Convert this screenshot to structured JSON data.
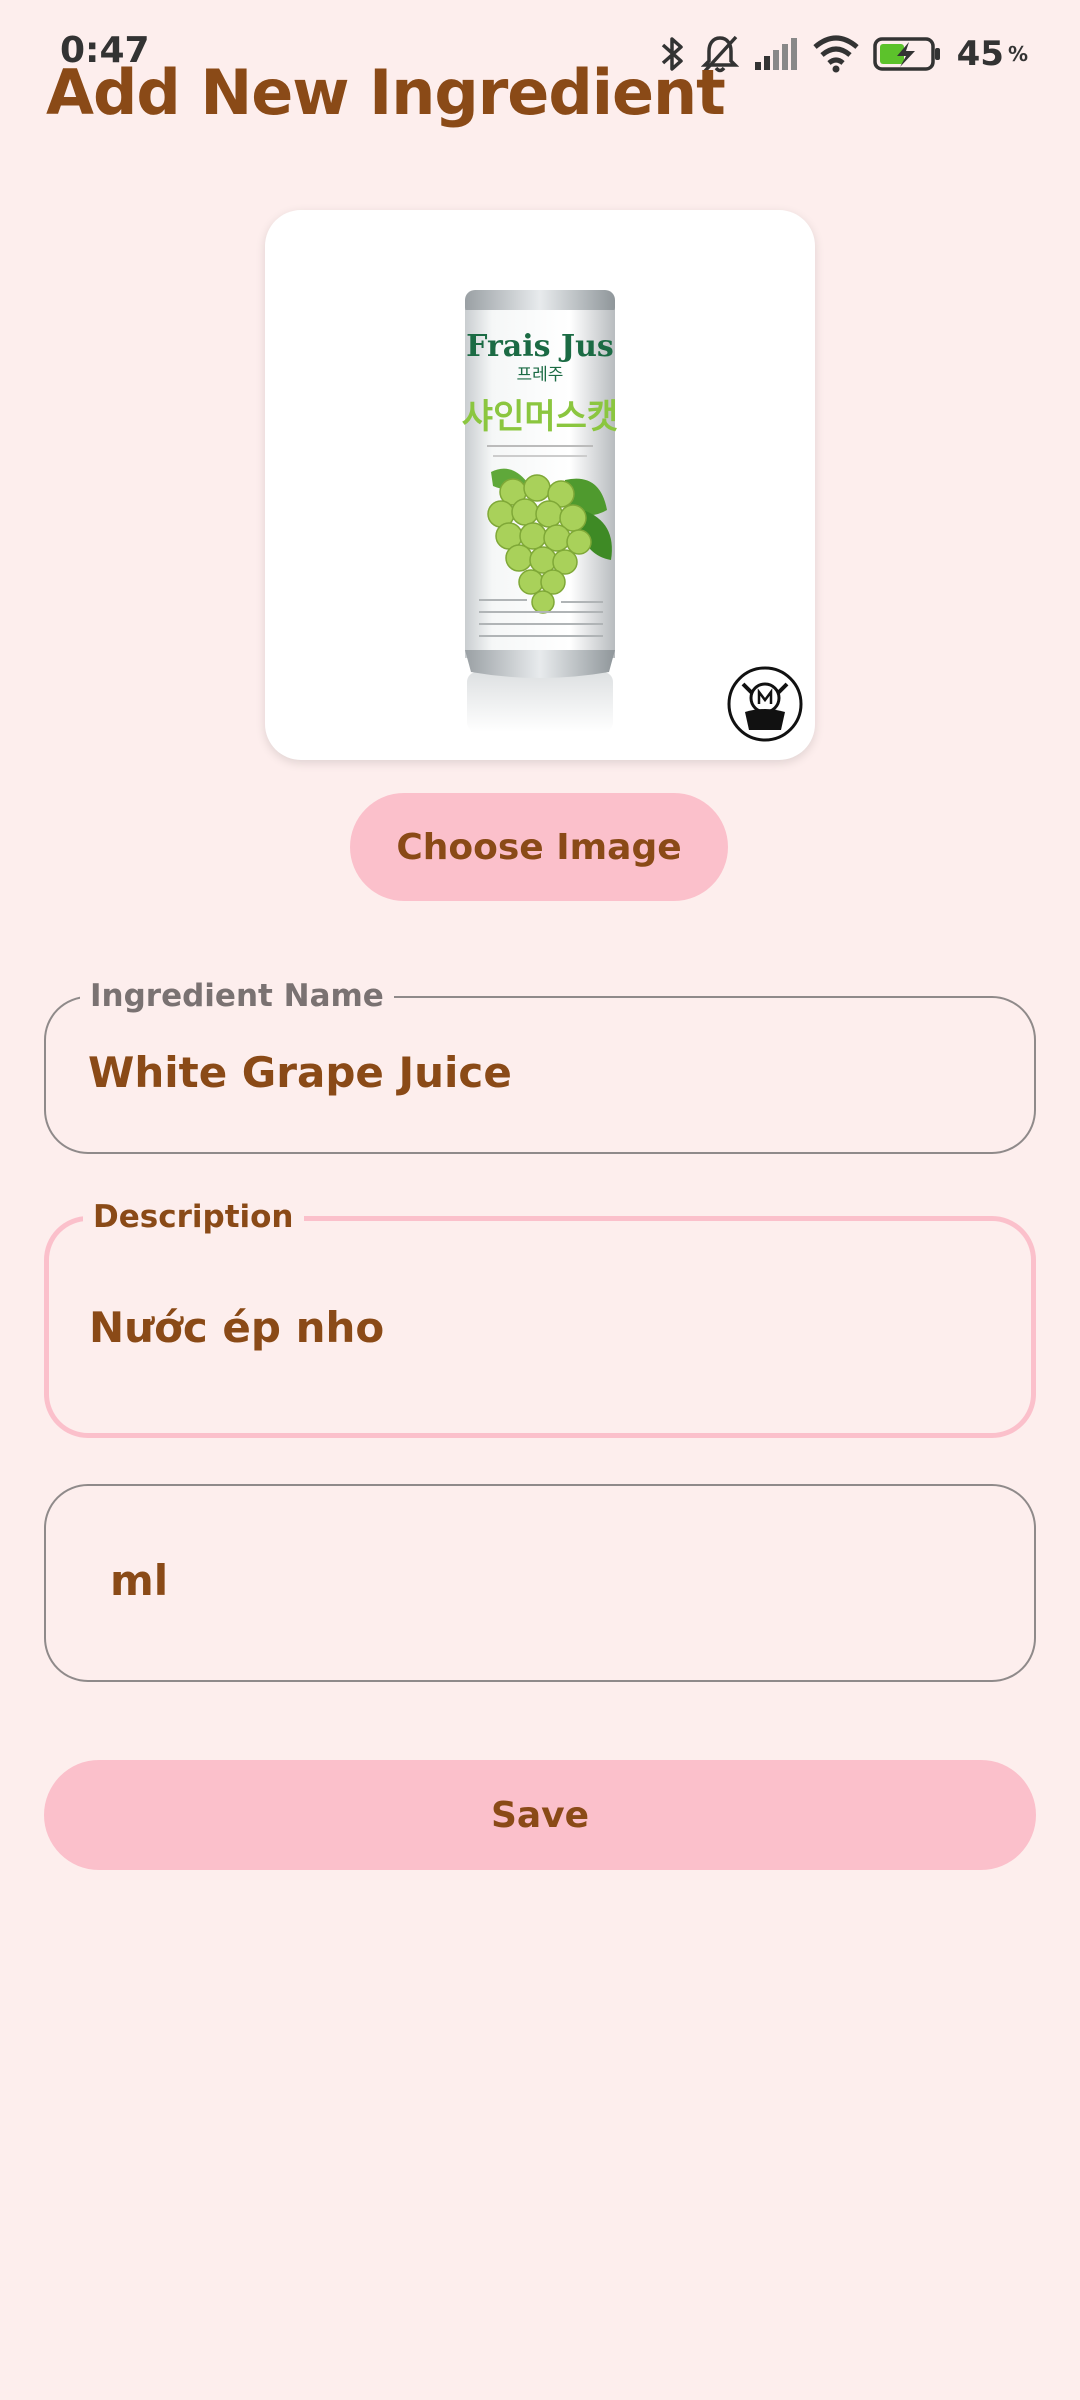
{
  "status_bar": {
    "time": "0:47",
    "battery_level": "45",
    "battery_unit": "%",
    "icons": [
      "bluetooth-icon",
      "bell-off-icon",
      "cell-signal-icon",
      "wifi-icon",
      "battery-charging-icon"
    ]
  },
  "page": {
    "title": "Add New Ingredient"
  },
  "image_picker": {
    "product_brand": "Frais Jus",
    "product_korean_name": "프레주",
    "product_flavor_korean": "샤인머스캣",
    "choose_label": "Choose Image"
  },
  "form": {
    "name_label": "Ingredient Name",
    "name_value": "White Grape Juice",
    "description_label": "Description",
    "description_value": "Nước ép nho",
    "unit_value": "ml"
  },
  "actions": {
    "save_label": "Save"
  },
  "colors": {
    "background": "#fdeeed",
    "accent_pink": "#fbc0cb",
    "text_brown": "#8a4a17",
    "outline_gray": "#8f8a8a"
  }
}
